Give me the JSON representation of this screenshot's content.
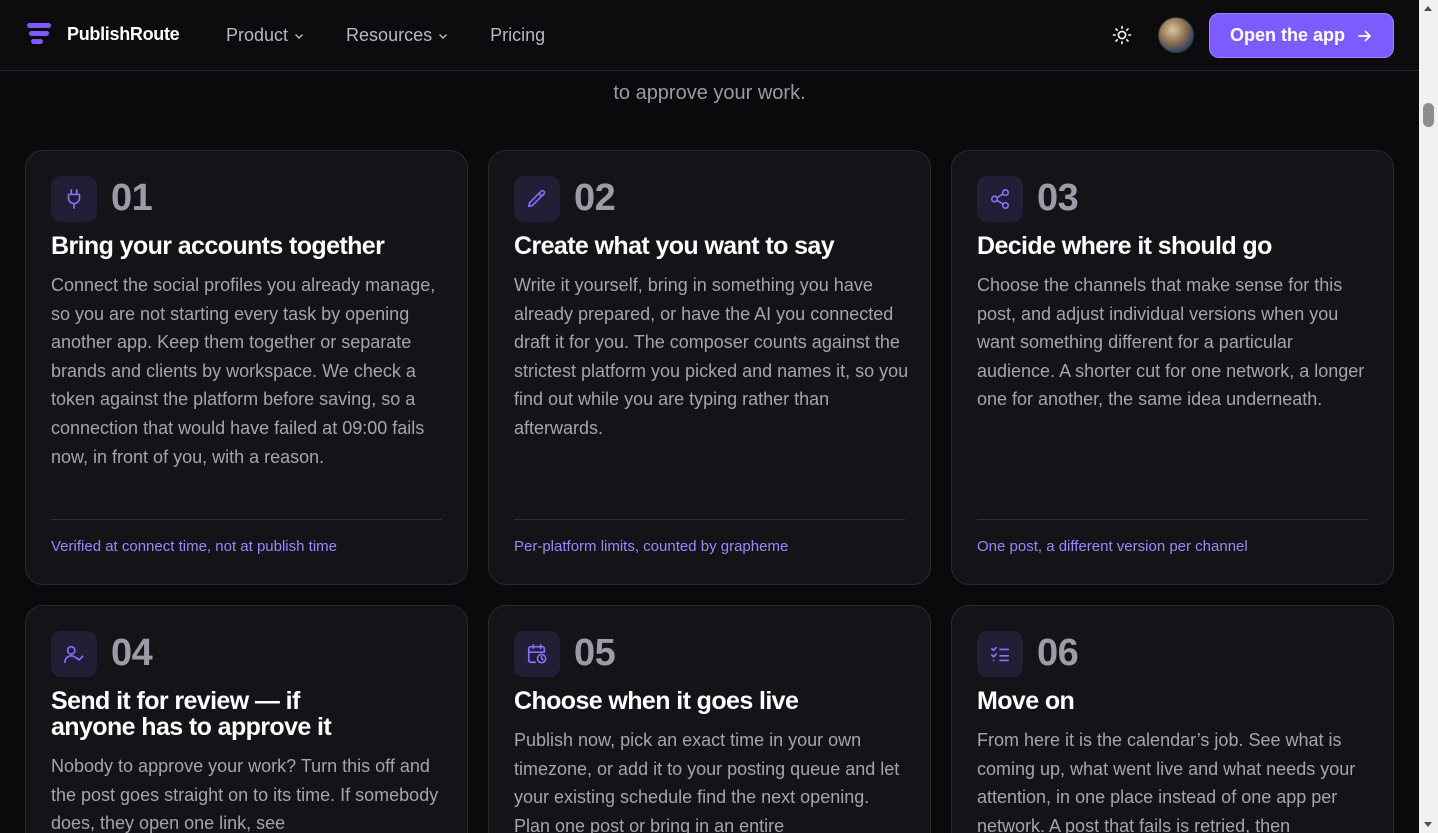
{
  "header": {
    "brand": "PublishRoute",
    "nav": [
      {
        "label": "Product"
      },
      {
        "label": "Resources"
      },
      {
        "label": "Pricing"
      }
    ],
    "open_app_label": "Open the app"
  },
  "intro": {
    "text": "to approve your work."
  },
  "cards": [
    {
      "number": "01",
      "icon": "plug-icon",
      "title": "Bring your accounts together",
      "text": "Connect the social profiles you already manage, so you are not starting every task by opening another app. Keep them together or separate brands and clients by workspace. We check a token against the platform before saving, so a connection that would have failed at 09:00 fails now, in front of you, with a reason.",
      "footer": "Verified at connect time, not at publish time"
    },
    {
      "number": "02",
      "icon": "pencil-icon",
      "title": "Create what you want to say",
      "text": "Write it yourself, bring in something you have already prepared, or have the AI you connected draft it for you. The composer counts against the strictest platform you picked and names it, so you find out while you are typing rather than afterwards.",
      "footer": "Per-platform limits, counted by grapheme"
    },
    {
      "number": "03",
      "icon": "share-icon",
      "title": "Decide where it should go",
      "text": "Choose the channels that make sense for this post, and adjust individual versions when you want something different for a particular audience. A shorter cut for one network, a longer one for another, the same idea underneath.",
      "footer": "One post, a different version per channel"
    },
    {
      "number": "04",
      "icon": "user-check-icon",
      "title": "Send it for review — if anyone has to approve it",
      "text": "Nobody to approve your work? Turn this off and the post goes straight on to its time. If somebody does, they open one link, see",
      "footer": ""
    },
    {
      "number": "05",
      "icon": "calendar-clock-icon",
      "title": "Choose when it goes live",
      "text": "Publish now, pick an exact time in your own timezone, or add it to your posting queue and let your existing schedule find the next opening. Plan one post or bring in an entire",
      "footer": ""
    },
    {
      "number": "06",
      "icon": "list-check-icon",
      "title": "Move on",
      "text": "From here it is the calendar’s job. See what is coming up, what went live and what needs your attention, in one place instead of one app per network. A post that fails is retried, then",
      "footer": ""
    }
  ],
  "colors": {
    "accent": "#7c5cff",
    "accent_text": "#9d86ff",
    "background": "#0a0a0c",
    "card": "#141418"
  }
}
